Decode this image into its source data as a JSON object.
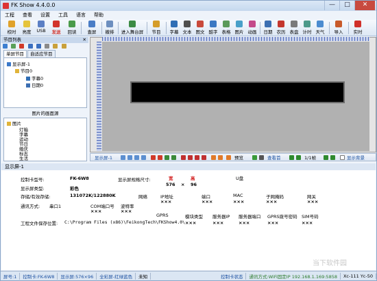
{
  "window": {
    "title": "FK Show 4.4.0.0",
    "buttons": [
      "—",
      "□",
      "✕"
    ]
  },
  "menu": [
    "工程",
    "查看",
    "设置",
    "工具",
    "语言",
    "帮助"
  ],
  "toolbar": {
    "items": [
      {
        "label": "校时",
        "color": "#e0a22b"
      },
      {
        "label": "亮度",
        "color": "#e5c43c"
      },
      {
        "label": "USB",
        "color": "#5b7fc4"
      },
      {
        "label": "发送",
        "color": "#d2342b"
      },
      {
        "label": "回读",
        "color": "#4a9b4a"
      },
      {
        "label": "查屏",
        "color": "#4a7dc6"
      },
      {
        "label": "撤排",
        "color": "#6d8fbf"
      },
      {
        "label": "进入舞台屏",
        "color": "#3b8b44"
      },
      {
        "label": "节目",
        "color": "#d59d2a"
      },
      {
        "label": "字幕",
        "color": "#2f6eb5"
      },
      {
        "label": "文本",
        "color": "#4f4f4f"
      },
      {
        "label": "图文",
        "color": "#c94a3b"
      },
      {
        "label": "酷字",
        "color": "#3a78c3"
      },
      {
        "label": "表格",
        "color": "#5a9a5a"
      },
      {
        "label": "图片",
        "color": "#49a0c9"
      },
      {
        "label": "动画",
        "color": "#c44a8a"
      },
      {
        "label": "日期",
        "color": "#3c6fb2"
      },
      {
        "label": "农历",
        "color": "#c4372e"
      },
      {
        "label": "表盘",
        "color": "#7a7a7a"
      },
      {
        "label": "计时",
        "color": "#4d9a8a"
      },
      {
        "label": "天气",
        "color": "#4c8cd0"
      },
      {
        "label": "导入",
        "color": "#c85a2a"
      },
      {
        "label": "实时",
        "color": "#d0302a"
      }
    ]
  },
  "left_panel": {
    "title": "节目列表",
    "tabs": [
      "单屏节目",
      "自适应节目"
    ],
    "tree": [
      {
        "label": "显示屏-1",
        "icon": "screen-icon"
      },
      {
        "label": "节目0",
        "icon": "folder-icon"
      },
      {
        "label": "字幕0",
        "icon": "text-icon"
      },
      {
        "label": "日期0",
        "icon": "date-icon"
      }
    ],
    "picture_source": {
      "title": "图片的画面源",
      "root": "图片",
      "items": [
        "灯箱",
        "字幕",
        "运动",
        "节日",
        "婚庆",
        "标志",
        "生活"
      ]
    }
  },
  "canvas_toolbar": {
    "screen_name": "显示屏-1",
    "preview": "预览",
    "find": "查看首",
    "page": "1/1帧",
    "show_bg": "显示背景"
  },
  "properties": {
    "title": "显示屏-1",
    "card_model_label": "控制卡型号:",
    "card_model": "FK-6W8",
    "size_label": "显示屏规格尺寸:",
    "width_label": "宽",
    "height_label": "高",
    "width": "576",
    "x": "×",
    "height": "96",
    "u_disk": "U盘",
    "type_label": "显示屏类型:",
    "type": "彩色",
    "storage_label": "存储/有效存储:",
    "storage": "131072K/122880K",
    "net_label": "网络",
    "ip_label": "IP地址",
    "port_label": "端口",
    "mac_label": "MAC",
    "mask_label": "子网掩码",
    "gw_label": "网关",
    "comm_label": "通讯方式:",
    "comm": "串口1",
    "com_label": "COM端口号",
    "baud_label": "波特率",
    "gprs_label": "GPRS",
    "module_label": "模块类型",
    "server_ip_label": "服务器IP",
    "server_port_label": "服务器端口",
    "gprs_pwd_label": "GPRS拨号密码",
    "sim_label": "SIM号码",
    "xxx": "×××",
    "path_label": "工程文件保存位置:",
    "path": "C:\\Program Files (x86)\\FeikongTech\\FKShow4.0\\"
  },
  "status": {
    "screen": "屏号:1",
    "card": "控制卡:FK-6W8",
    "size": "显示屏:576×96",
    "mode": "全彩屏-红绿蓝色",
    "unknown": "未知",
    "card_state": "控制卡状态",
    "comm": "通讯方式:WiFi固定IP 192.168.1.169:5858",
    "coord": "Xc-111 Yc-50"
  },
  "watermark": "当下软件园"
}
